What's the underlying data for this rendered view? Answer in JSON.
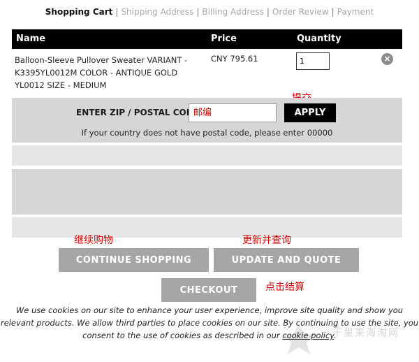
{
  "breadcrumb": {
    "items": [
      {
        "label": "Shopping Cart",
        "active": true
      },
      {
        "label": "Shipping Address",
        "active": false
      },
      {
        "label": "Billing Address",
        "active": false
      },
      {
        "label": "Order Review",
        "active": false
      },
      {
        "label": "Payment",
        "active": false
      }
    ],
    "separator": "|"
  },
  "table": {
    "headers": {
      "name": "Name",
      "price": "Price",
      "quantity": "Quantity"
    }
  },
  "item": {
    "name": "Balloon-Sleeve Pullover Sweater VARIANT - K3395YL0012M COLOR - ANTIQUE GOLD YL0012 SIZE - MEDIUM",
    "price": "CNY 795.61",
    "quantity": "1",
    "remove_icon": "close-circle-icon"
  },
  "zip": {
    "label": "ENTER ZIP / POSTAL CODE",
    "placeholder": "邮编",
    "value": "",
    "apply_label": "APPLY",
    "help": "If your country does not have postal code, please enter 00000"
  },
  "annotations": {
    "submit": "提交",
    "continue": "继续购物",
    "update": "更新并查询",
    "checkout": "点击结算"
  },
  "actions": {
    "continue_shopping": "CONTINUE SHOPPING",
    "update_and_quote": "UPDATE AND QUOTE",
    "checkout": "CHECKOUT"
  },
  "cookie": {
    "text_before": "We use cookies on our site to enhance your user experience, improve site quality and show you relevant products. We allow third parties to place cookies on our site. By continuing to use the site, you consent to the use of cookies as described in our ",
    "link": "cookie policy",
    "text_after": "."
  },
  "watermark": {
    "text": "千里来海淘网",
    "icon": "star-icon"
  },
  "colors": {
    "header_bg": "#000000",
    "panel_gray": "#d6d6d6",
    "button_gray": "#a6a6a6",
    "annotation_red": "#d10000"
  }
}
